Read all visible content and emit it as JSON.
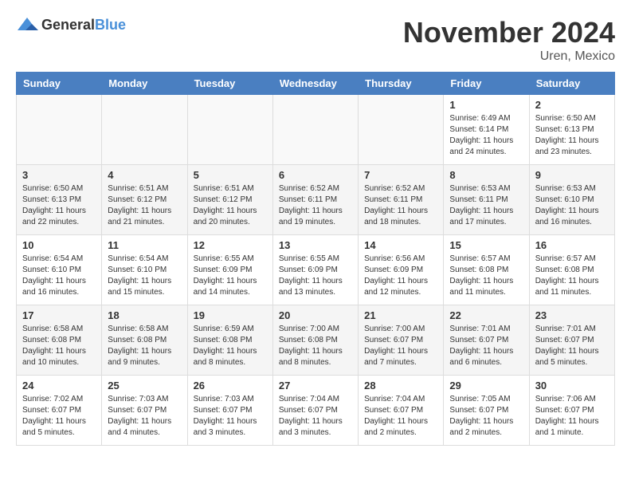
{
  "header": {
    "logo": {
      "general": "General",
      "blue": "Blue"
    },
    "title": "November 2024",
    "subtitle": "Uren, Mexico"
  },
  "weekdays": [
    "Sunday",
    "Monday",
    "Tuesday",
    "Wednesday",
    "Thursday",
    "Friday",
    "Saturday"
  ],
  "weeks": [
    [
      {
        "day": "",
        "info": ""
      },
      {
        "day": "",
        "info": ""
      },
      {
        "day": "",
        "info": ""
      },
      {
        "day": "",
        "info": ""
      },
      {
        "day": "",
        "info": ""
      },
      {
        "day": "1",
        "info": "Sunrise: 6:49 AM\nSunset: 6:14 PM\nDaylight: 11 hours and 24 minutes."
      },
      {
        "day": "2",
        "info": "Sunrise: 6:50 AM\nSunset: 6:13 PM\nDaylight: 11 hours and 23 minutes."
      }
    ],
    [
      {
        "day": "3",
        "info": "Sunrise: 6:50 AM\nSunset: 6:13 PM\nDaylight: 11 hours and 22 minutes."
      },
      {
        "day": "4",
        "info": "Sunrise: 6:51 AM\nSunset: 6:12 PM\nDaylight: 11 hours and 21 minutes."
      },
      {
        "day": "5",
        "info": "Sunrise: 6:51 AM\nSunset: 6:12 PM\nDaylight: 11 hours and 20 minutes."
      },
      {
        "day": "6",
        "info": "Sunrise: 6:52 AM\nSunset: 6:11 PM\nDaylight: 11 hours and 19 minutes."
      },
      {
        "day": "7",
        "info": "Sunrise: 6:52 AM\nSunset: 6:11 PM\nDaylight: 11 hours and 18 minutes."
      },
      {
        "day": "8",
        "info": "Sunrise: 6:53 AM\nSunset: 6:11 PM\nDaylight: 11 hours and 17 minutes."
      },
      {
        "day": "9",
        "info": "Sunrise: 6:53 AM\nSunset: 6:10 PM\nDaylight: 11 hours and 16 minutes."
      }
    ],
    [
      {
        "day": "10",
        "info": "Sunrise: 6:54 AM\nSunset: 6:10 PM\nDaylight: 11 hours and 16 minutes."
      },
      {
        "day": "11",
        "info": "Sunrise: 6:54 AM\nSunset: 6:10 PM\nDaylight: 11 hours and 15 minutes."
      },
      {
        "day": "12",
        "info": "Sunrise: 6:55 AM\nSunset: 6:09 PM\nDaylight: 11 hours and 14 minutes."
      },
      {
        "day": "13",
        "info": "Sunrise: 6:55 AM\nSunset: 6:09 PM\nDaylight: 11 hours and 13 minutes."
      },
      {
        "day": "14",
        "info": "Sunrise: 6:56 AM\nSunset: 6:09 PM\nDaylight: 11 hours and 12 minutes."
      },
      {
        "day": "15",
        "info": "Sunrise: 6:57 AM\nSunset: 6:08 PM\nDaylight: 11 hours and 11 minutes."
      },
      {
        "day": "16",
        "info": "Sunrise: 6:57 AM\nSunset: 6:08 PM\nDaylight: 11 hours and 11 minutes."
      }
    ],
    [
      {
        "day": "17",
        "info": "Sunrise: 6:58 AM\nSunset: 6:08 PM\nDaylight: 11 hours and 10 minutes."
      },
      {
        "day": "18",
        "info": "Sunrise: 6:58 AM\nSunset: 6:08 PM\nDaylight: 11 hours and 9 minutes."
      },
      {
        "day": "19",
        "info": "Sunrise: 6:59 AM\nSunset: 6:08 PM\nDaylight: 11 hours and 8 minutes."
      },
      {
        "day": "20",
        "info": "Sunrise: 7:00 AM\nSunset: 6:08 PM\nDaylight: 11 hours and 8 minutes."
      },
      {
        "day": "21",
        "info": "Sunrise: 7:00 AM\nSunset: 6:07 PM\nDaylight: 11 hours and 7 minutes."
      },
      {
        "day": "22",
        "info": "Sunrise: 7:01 AM\nSunset: 6:07 PM\nDaylight: 11 hours and 6 minutes."
      },
      {
        "day": "23",
        "info": "Sunrise: 7:01 AM\nSunset: 6:07 PM\nDaylight: 11 hours and 5 minutes."
      }
    ],
    [
      {
        "day": "24",
        "info": "Sunrise: 7:02 AM\nSunset: 6:07 PM\nDaylight: 11 hours and 5 minutes."
      },
      {
        "day": "25",
        "info": "Sunrise: 7:03 AM\nSunset: 6:07 PM\nDaylight: 11 hours and 4 minutes."
      },
      {
        "day": "26",
        "info": "Sunrise: 7:03 AM\nSunset: 6:07 PM\nDaylight: 11 hours and 3 minutes."
      },
      {
        "day": "27",
        "info": "Sunrise: 7:04 AM\nSunset: 6:07 PM\nDaylight: 11 hours and 3 minutes."
      },
      {
        "day": "28",
        "info": "Sunrise: 7:04 AM\nSunset: 6:07 PM\nDaylight: 11 hours and 2 minutes."
      },
      {
        "day": "29",
        "info": "Sunrise: 7:05 AM\nSunset: 6:07 PM\nDaylight: 11 hours and 2 minutes."
      },
      {
        "day": "30",
        "info": "Sunrise: 7:06 AM\nSunset: 6:07 PM\nDaylight: 11 hours and 1 minute."
      }
    ]
  ]
}
